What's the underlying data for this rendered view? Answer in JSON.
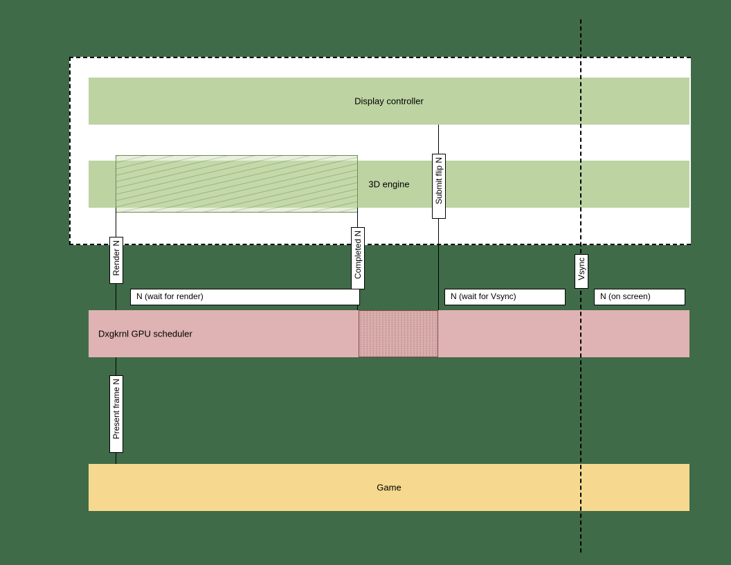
{
  "lanes": {
    "display_controller": "Display controller",
    "engine_3d": "3D engine",
    "scheduler": "Dxgkrnl GPU scheduler",
    "game": "Game"
  },
  "chips": {
    "wait_render": "N (wait for render)",
    "wait_vsync": "N (wait for Vsync)",
    "on_screen": "N (on screen)"
  },
  "vlabels": {
    "render_n": "Render N",
    "completed_n": "Completed N",
    "submit_flip_n": "Submit flip N",
    "present_frame_n": "Present frame N",
    "vsync": "Vsync"
  },
  "colors": {
    "bg": "#3f6b49",
    "green_lane": "#bdd3a2",
    "pink_lane": "#dfb3b3",
    "yellow_lane": "#f6d98f"
  }
}
